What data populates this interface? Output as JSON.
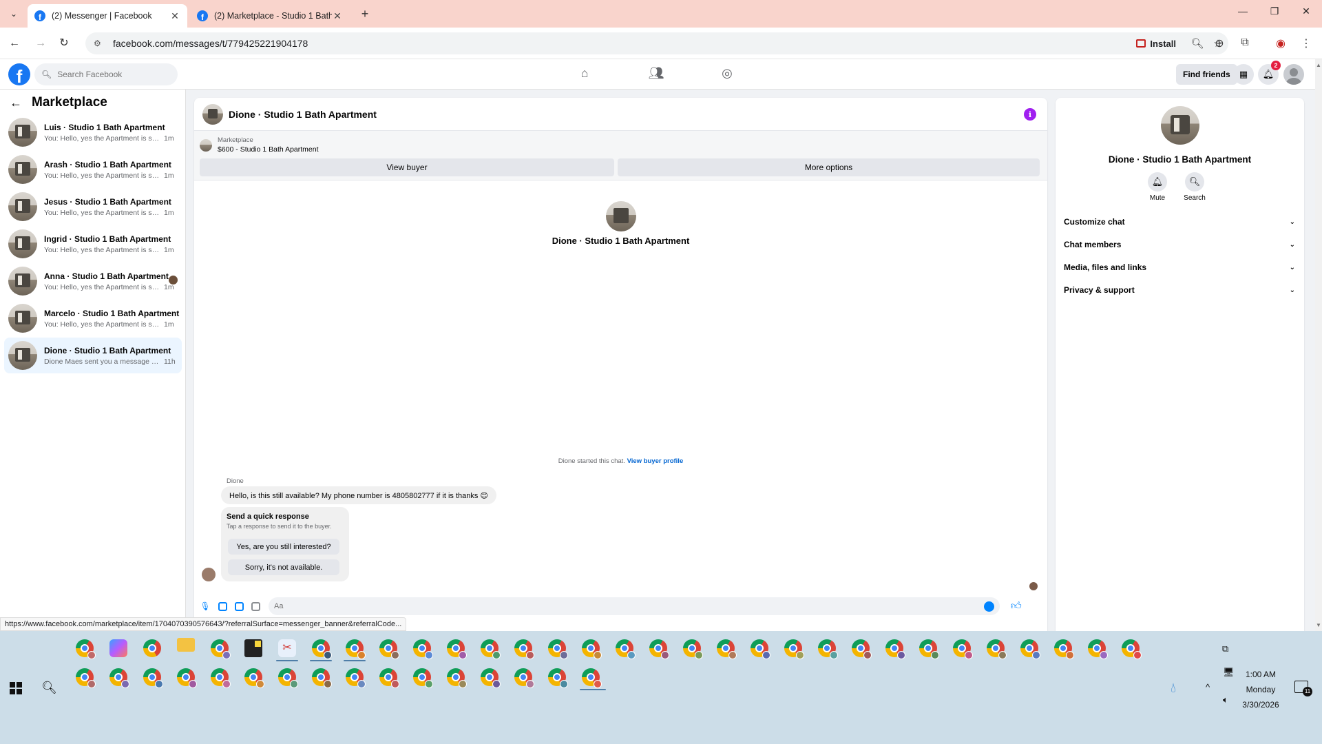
{
  "browser": {
    "tabs": [
      {
        "title": "(2) Messenger | Facebook",
        "active": true
      },
      {
        "title": "(2) Marketplace - Studio 1 Bath",
        "active": false
      }
    ],
    "url": "facebook.com/messages/t/779425221904178",
    "install_label": "Install",
    "status_url": "https://www.facebook.com/marketplace/item/1704070390576643/?referralSurface=messenger_banner&referralCode..."
  },
  "fb_header": {
    "search_placeholder": "Search Facebook",
    "find_friends": "Find friends",
    "notification_count": "2"
  },
  "left": {
    "title": "Marketplace",
    "conversations": [
      {
        "name": "Luis · Studio 1 Bath Apartment",
        "preview": "You: Hello, yes the Apartment is still a...",
        "time": "1m",
        "selected": false
      },
      {
        "name": "Arash · Studio 1 Bath Apartment",
        "preview": "You: Hello, yes the Apartment is still a...",
        "time": "1m",
        "selected": false
      },
      {
        "name": "Jesus · Studio 1 Bath Apartment",
        "preview": "You: Hello, yes the Apartment is still a...",
        "time": "1m",
        "selected": false
      },
      {
        "name": "Ingrid · Studio 1 Bath Apartment",
        "preview": "You: Hello, yes the Apartment is still a...",
        "time": "1m",
        "selected": false
      },
      {
        "name": "Anna · Studio 1 Bath Apartment",
        "preview": "You: Hello, yes the Apartment is stil...",
        "time": "1m",
        "selected": false
      },
      {
        "name": "Marcelo · Studio 1 Bath Apartment",
        "preview": "You: Hello, yes the Apartment is still a...",
        "time": "1m",
        "selected": false
      },
      {
        "name": "Dione · Studio 1 Bath Apartment",
        "preview": "Dione Maes sent you a message abo...",
        "time": "11h",
        "selected": true
      }
    ]
  },
  "chat": {
    "header_name": "Dione · Studio 1 Bath Apartment",
    "marketplace_label": "Marketplace",
    "listing": "$600 - Studio 1 Bath Apartment",
    "view_buyer": "View buyer",
    "more_options": "More options",
    "intro_name": "Dione · Studio 1 Bath Apartment",
    "started_text": "Dione started this chat.",
    "view_buyer_profile": "View buyer profile",
    "sender": "Dione",
    "message": "Hello, is this still available? My phone number is 4805802777 if it is thanks 😊",
    "quick_title": "Send a quick response",
    "quick_sub": "Tap a response to send it to the buyer.",
    "quick_options": [
      "Yes, are you still interested?",
      "Sorry, it's not available."
    ],
    "composer_placeholder": "Aa"
  },
  "details": {
    "name": "Dione · Studio 1 Bath Apartment",
    "actions": [
      "Mute",
      "Search"
    ],
    "sections": [
      "Customize chat",
      "Chat members",
      "Media, files and links",
      "Privacy & support"
    ]
  },
  "taskbar": {
    "time": "1:00 AM",
    "day": "Monday",
    "date": "3/30/2026",
    "notification_count": "11"
  }
}
